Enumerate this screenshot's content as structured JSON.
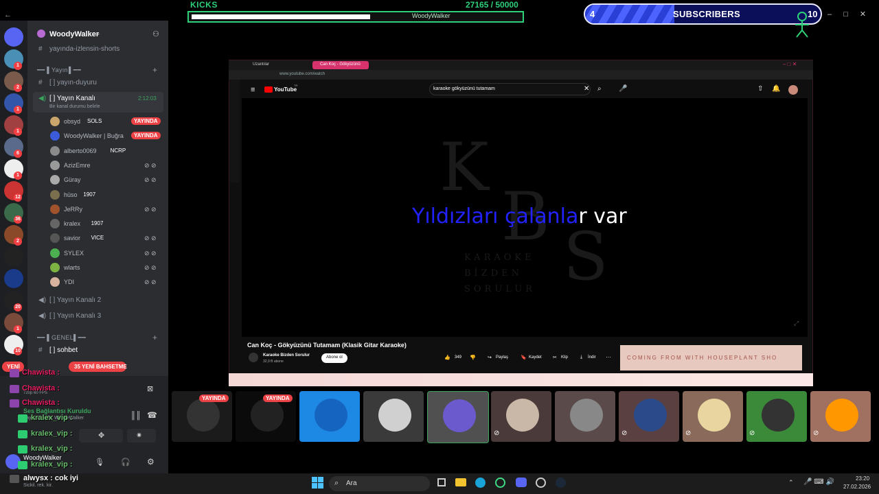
{
  "top_overlay": {
    "kicks_label": "KICKS",
    "kicks_count": "27165 / 50000",
    "kicks_progress": 0.54,
    "kicks_user": "WoodyWalker",
    "subs_left": "4",
    "subs_title": "SUBSCRIBERS",
    "subs_right": "10"
  },
  "window_controls": {
    "minimize": "–",
    "maximize": "□",
    "close": "✕"
  },
  "servers": [
    {
      "badge": ""
    },
    {
      "badge": "1"
    },
    {
      "badge": "2"
    },
    {
      "badge": "1"
    },
    {
      "badge": "1"
    },
    {
      "badge": "6"
    },
    {
      "badge": "1"
    },
    {
      "badge": "12"
    },
    {
      "badge": "36"
    },
    {
      "badge": "2"
    },
    {
      "badge": ""
    },
    {
      "badge": ""
    },
    {
      "badge": "20"
    },
    {
      "badge": "1"
    },
    {
      "badge": "10"
    }
  ],
  "guild": {
    "name": "WoodyWalker"
  },
  "channels": {
    "top_channel": "yayında-izlensin-shorts",
    "cat_yayin": "Yayın",
    "yayin_duyuru": "[ ] yayın-duyuru",
    "voice_active": "[ ] Yayın Kanalı",
    "voice_timer": "2:12:03",
    "voice_status": "Bir kanal durumu belirle",
    "voice_2": "[ ] Yayın Kanalı 2",
    "voice_3": "[ ] Yayın Kanalı 3",
    "cat_genel": "GENEL",
    "sohbet": "[ ] sohbet"
  },
  "voice_users": [
    {
      "name": "obsyd",
      "tag": "SOLS",
      "live": "YAYINDA",
      "color": "#c9a46b"
    },
    {
      "name": "WoodyWalker | Buğra",
      "tag": "",
      "live": "YAYINDA",
      "color": "#3b5bdb"
    },
    {
      "name": "alberto0069",
      "tag": "NCRP",
      "live": "",
      "color": "#8a8a8a"
    },
    {
      "name": "AzizEmre",
      "tag": "",
      "live": "",
      "color": "#999"
    },
    {
      "name": "Güray",
      "tag": "",
      "live": "",
      "color": "#aaa"
    },
    {
      "name": "hüso",
      "tag": "1907",
      "live": "",
      "color": "#7c6f4d"
    },
    {
      "name": "JeRRy",
      "tag": "",
      "live": "",
      "color": "#a0522d"
    },
    {
      "name": "kralex",
      "tag": "1907",
      "live": "",
      "color": "#666"
    },
    {
      "name": "savior",
      "tag": "VICE",
      "live": "",
      "color": "#555"
    },
    {
      "name": "SYLEX",
      "tag": "",
      "live": "",
      "color": "#4caf50"
    },
    {
      "name": "wlarts",
      "tag": "",
      "live": "",
      "color": "#7cb342"
    },
    {
      "name": "YDI",
      "tag": "",
      "live": "",
      "color": "#d8b4a0"
    }
  ],
  "mention_pill": "35 YENİ BAHSETME",
  "new_pill": "YENİ",
  "chat": [
    {
      "user": "Chawista :",
      "color": "#e91e63"
    },
    {
      "user": "Chawista :",
      "color": "#e91e63"
    },
    {
      "user": "Chawista :",
      "color": "#e91e63"
    },
    {
      "user": "kralex_vip :",
      "color": "#66bb6a"
    },
    {
      "user": "kralex_vip :",
      "color": "#66bb6a"
    },
    {
      "user": "kralex_vip :",
      "color": "#66bb6a"
    },
    {
      "user": "kralex_vip :",
      "color": "#66bb6a"
    },
    {
      "user": "alwysx : cok iyi",
      "color": "#ffffff"
    }
  ],
  "connection": {
    "title": "Ses Bağlantısı Kuruldu",
    "subtitle": "Yayın Kanalı / WoodyWalker",
    "fps": "720p 60 FPS"
  },
  "user_panel": {
    "name": "WoodyWalker",
    "status": "Sickil. rek. kir."
  },
  "browser": {
    "tab1": "Uzantılar",
    "tab2": "Can Koç - Gökyüzünü",
    "url": "www.youtube.com/watch",
    "yt_logo": "YouTube",
    "yt_region": "TR",
    "search_value": "karaoke  gökyüzünü tutamam",
    "lyrics_sung": "Yıldızları çalanla",
    "lyrics_rest": "r var",
    "kbs_letters": [
      "K",
      "B",
      "S"
    ],
    "kbs_words": [
      "KARAOKE",
      "BİZDEN",
      "SORULUR"
    ],
    "video_title": "Can Koç - Gökyüzünü Tutamam (Klasik Gitar Karaoke)",
    "channel_name": "Karaoke Bizden Sorulur",
    "channel_subs": "32,9 B abone",
    "subscribe": "Abone ol",
    "likes": "349",
    "share": "Paylaş",
    "save": "Kaydet",
    "clip": "Klip",
    "download": "İndir",
    "promo_text": "COMING FROM WITH   HOUSEPLANT SHO"
  },
  "thumbnails": [
    {
      "label": "YAYINDA",
      "bg": "#1b1b1b",
      "muted": false
    },
    {
      "label": "YAYINDA",
      "bg": "#0b0b0b",
      "muted": false
    },
    {
      "label": "",
      "bg": "#1e88e5",
      "muted": false
    },
    {
      "label": "",
      "bg": "#3a3a3a",
      "muted": false
    },
    {
      "label": "",
      "bg": "#505050",
      "muted": false
    },
    {
      "label": "",
      "bg": "#4a3a3a",
      "muted": true
    },
    {
      "label": "",
      "bg": "#5a4a4a",
      "muted": false
    },
    {
      "label": "",
      "bg": "#5a4040",
      "muted": true
    },
    {
      "label": "",
      "bg": "#8a6a5a",
      "muted": true
    },
    {
      "label": "",
      "bg": "#3a8a3a",
      "muted": true
    },
    {
      "label": "",
      "bg": "#a07060",
      "muted": true
    },
    {
      "label": "",
      "bg": "#4a3a3a",
      "muted": true
    }
  ],
  "taskbar": {
    "search_placeholder": "Ara",
    "time": "23:20",
    "date": "27.02.2026"
  }
}
